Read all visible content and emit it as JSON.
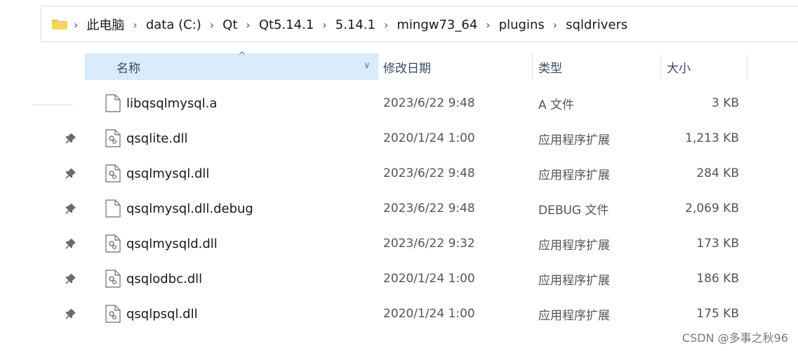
{
  "address": {
    "icon": "folder-icon",
    "path": [
      "此电脑",
      "data (C:)",
      "Qt",
      "Qt5.14.1",
      "5.14.1",
      "mingw73_64",
      "plugins",
      "sqldrivers"
    ]
  },
  "header": {
    "name": "名称",
    "date": "修改日期",
    "type": "类型",
    "size": "大小"
  },
  "files": [
    {
      "name": "libqsqlmysql.a",
      "date": "2023/6/22 9:48",
      "type": "A 文件",
      "size": "3 KB",
      "icon": "file-icon",
      "pinned": false
    },
    {
      "name": "qsqlite.dll",
      "date": "2020/1/24 1:00",
      "type": "应用程序扩展",
      "size": "1,213 KB",
      "icon": "dll-icon",
      "pinned": true
    },
    {
      "name": "qsqlmysql.dll",
      "date": "2023/6/22 9:48",
      "type": "应用程序扩展",
      "size": "284 KB",
      "icon": "dll-icon",
      "pinned": true
    },
    {
      "name": "qsqlmysql.dll.debug",
      "date": "2023/6/22 9:48",
      "type": "DEBUG 文件",
      "size": "2,069 KB",
      "icon": "file-icon",
      "pinned": true
    },
    {
      "name": "qsqlmysqld.dll",
      "date": "2023/6/22 9:32",
      "type": "应用程序扩展",
      "size": "173 KB",
      "icon": "dll-icon",
      "pinned": true
    },
    {
      "name": "qsqlodbc.dll",
      "date": "2020/1/24 1:00",
      "type": "应用程序扩展",
      "size": "186 KB",
      "icon": "dll-icon",
      "pinned": true
    },
    {
      "name": "qsqlpsql.dll",
      "date": "2020/1/24 1:00",
      "type": "应用程序扩展",
      "size": "175 KB",
      "icon": "dll-icon",
      "pinned": true
    }
  ],
  "watermark": "CSDN @多事之秋96",
  "colors": {
    "header_selected": "#d9ecfc",
    "folder": "#f3c13a"
  }
}
